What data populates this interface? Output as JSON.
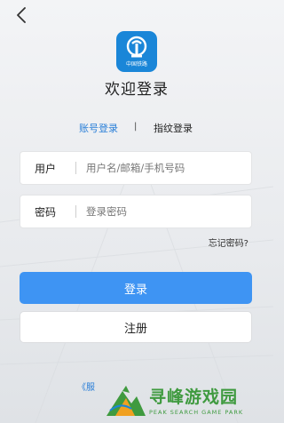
{
  "header": {
    "back_icon": "chevron-left-icon"
  },
  "logo": {
    "icon": "railway-logo-icon",
    "caption": "中国铁路",
    "color": "#1a86d8"
  },
  "title": "欢迎登录",
  "tabs": [
    {
      "label": "账号登录",
      "active": true
    },
    {
      "label": "指纹登录",
      "active": false
    }
  ],
  "tab_separator": "|",
  "form": {
    "username": {
      "label": "用户",
      "placeholder": "用户名/邮箱/手机号码",
      "value": ""
    },
    "password": {
      "label": "密码",
      "placeholder": "登录密码",
      "value": ""
    }
  },
  "forgot_password": "忘记密码?",
  "buttons": {
    "login": "登录",
    "register": "注册"
  },
  "agreement": "《服",
  "watermark": {
    "title": "寻峰游戏园",
    "subtitle": "PEAK SEARCH GAME PARK"
  },
  "colors": {
    "accent": "#3e94f3",
    "link": "#2a7fd8",
    "watermark": "#3f9a3f"
  }
}
